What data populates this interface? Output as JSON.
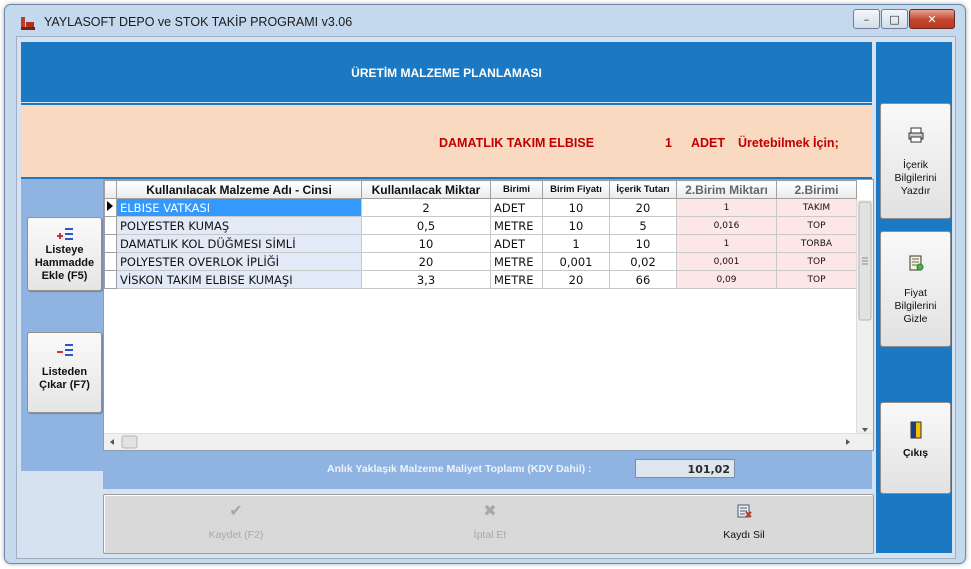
{
  "window": {
    "title": "YAYLASOFT DEPO ve STOK TAKİP PROGRAMI v3.06"
  },
  "header": {
    "title": "ÜRETİM MALZEME PLANLAMASI"
  },
  "info": {
    "product": "DAMATLIK TAKIM ELBISE",
    "quantity": "1",
    "unit": "ADET",
    "suffix": "Üretebilmek İçin;"
  },
  "left_buttons": {
    "add_label": "Listeye\nHammadde\nEkle (F5)",
    "remove_label": "Listeden\nÇıkar (F7)"
  },
  "right_buttons": {
    "print_label": "İçerik\nBilgilerini\nYazdır",
    "price_label": "Fiyat\nBilgilerini\nGizle",
    "exit_label": "Çıkış"
  },
  "grid": {
    "columns": [
      "Kullanılacak Malzeme Adı - Cinsi",
      "Kullanılacak Miktar",
      "Birimi",
      "Birim Fiyatı",
      "İçerik Tutarı",
      "2.Birim Miktarı",
      "2.Birimi"
    ],
    "rows": [
      [
        "ELBISE VATKASI",
        "2",
        "ADET",
        "10",
        "20",
        "1",
        "TAKIM"
      ],
      [
        "POLYESTER KUMAŞ",
        "0,5",
        "METRE",
        "10",
        "5",
        "0,016",
        "TOP"
      ],
      [
        "DAMATLIK KOL DÜĞMESI SİMLİ",
        "10",
        "ADET",
        "1",
        "10",
        "1",
        "TORBA"
      ],
      [
        "POLYESTER OVERLOK İPLİĞİ",
        "20",
        "METRE",
        "0,001",
        "0,02",
        "0,001",
        "TOP"
      ],
      [
        "VİSKON TAKIM ELBISE KUMAŞI",
        "3,3",
        "METRE",
        "20",
        "66",
        "0,09",
        "TOP"
      ]
    ]
  },
  "total": {
    "label": "Anlık Yaklaşık Malzeme Maliyet Toplamı (KDV Dahil) :",
    "value": "101,02"
  },
  "bottom_bar": {
    "save_label": "Kaydet (F2)",
    "cancel_label": "İptal Et",
    "delete_label": "Kaydı Sil"
  }
}
